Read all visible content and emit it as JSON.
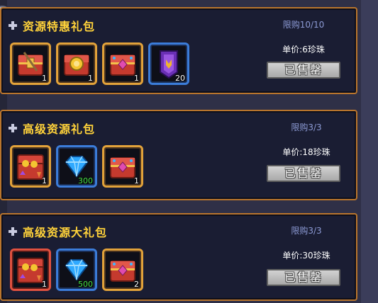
{
  "packs": [
    {
      "title": "资源特惠礼包",
      "limit": "限购10/10",
      "price": "单价:6珍珠",
      "button": "已售罄",
      "items": [
        {
          "icon": "chest-gold-icon",
          "qty": "1",
          "frame": "gold"
        },
        {
          "icon": "chest-coin-icon",
          "qty": "1",
          "frame": "gold"
        },
        {
          "icon": "chest-gem-icon",
          "qty": "1",
          "frame": "gold"
        },
        {
          "icon": "purple-badge-icon",
          "qty": "20",
          "frame": "blue"
        }
      ]
    },
    {
      "title": "高级资源礼包",
      "limit": "限购3/3",
      "price": "单价:18珍珠",
      "button": "已售罄",
      "items": [
        {
          "icon": "treasure-chest-open-icon",
          "qty": "1",
          "frame": "gold"
        },
        {
          "icon": "blue-diamond-icon",
          "qty": "300",
          "frame": "blue"
        },
        {
          "icon": "chest-gem-icon",
          "qty": "1",
          "frame": "gold"
        }
      ]
    },
    {
      "title": "高级资源大礼包",
      "limit": "限购3/3",
      "price": "单价:30珍珠",
      "button": "已售罄",
      "items": [
        {
          "icon": "treasure-chest-open-icon",
          "qty": "1",
          "frame": "red"
        },
        {
          "icon": "blue-diamond-icon",
          "qty": "500",
          "frame": "blue"
        },
        {
          "icon": "chest-gem-icon",
          "qty": "2",
          "frame": "gold"
        }
      ]
    }
  ],
  "colors": {
    "title": "#ffd23a",
    "limit": "#8d9bd6",
    "border": "#b9752d",
    "panel": "#1a1d33"
  }
}
